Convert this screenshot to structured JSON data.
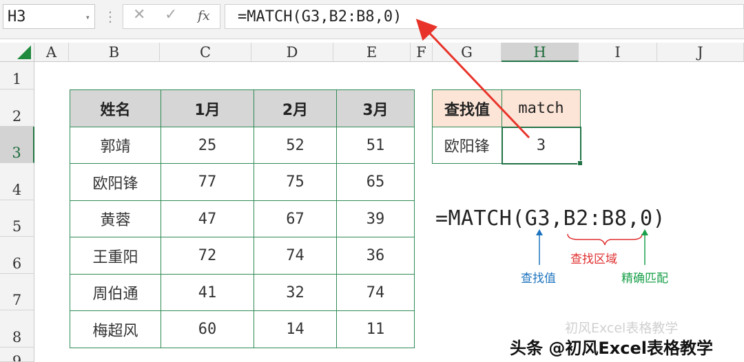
{
  "formula_bar": {
    "name_box": "H3",
    "name_box_arrow": "▾",
    "separator": "⋮",
    "cancel_icon": "✕",
    "enter_icon": "✓",
    "fx_label": "fx",
    "formula": "=MATCH(G3,B2:B8,0)"
  },
  "columns": [
    "A",
    "B",
    "C",
    "D",
    "E",
    "F",
    "G",
    "H",
    "I",
    "J"
  ],
  "rows": [
    "1",
    "2",
    "3",
    "4",
    "5",
    "6",
    "7",
    "8",
    "9"
  ],
  "selected_column": "H",
  "selected_row": "3",
  "table": {
    "headers": [
      "姓名",
      "1月",
      "2月",
      "3月"
    ],
    "rows": [
      [
        "郭靖",
        "25",
        "52",
        "51"
      ],
      [
        "欧阳锋",
        "77",
        "75",
        "65"
      ],
      [
        "黄蓉",
        "47",
        "67",
        "39"
      ],
      [
        "王重阳",
        "72",
        "74",
        "36"
      ],
      [
        "周伯通",
        "41",
        "32",
        "74"
      ],
      [
        "梅超风",
        "60",
        "14",
        "11"
      ]
    ]
  },
  "lookup": {
    "header_label": "查找值",
    "header_match": "match",
    "value": "欧阳锋",
    "result": "3"
  },
  "annotation": {
    "formula": "=MATCH(G3,B2:B8,0)",
    "lookup_value_label": "查找值",
    "range_label": "查找区域",
    "exact_label": "精确匹配",
    "colors": {
      "lookup": "#1e73be",
      "range": "#e03030",
      "exact": "#1aa04a",
      "arrow": "#e8332a"
    }
  },
  "watermark": {
    "faint": "初风Excel表格教学",
    "bottom": "头条 @初风Excel表格教学"
  }
}
